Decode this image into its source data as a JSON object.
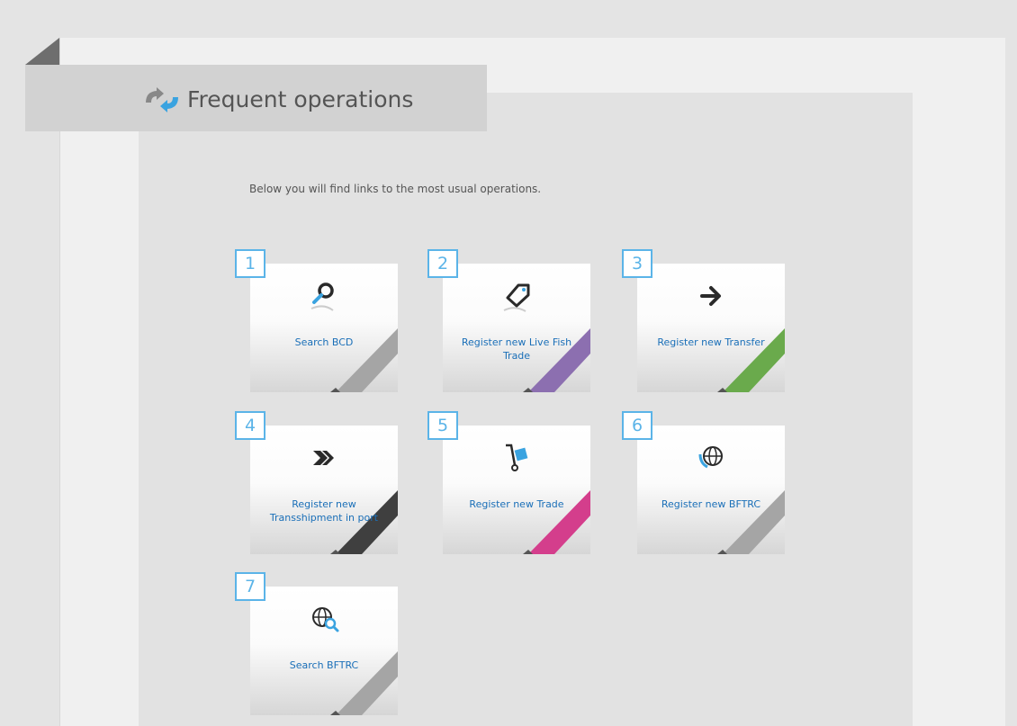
{
  "header": {
    "title": "Frequent operations",
    "icon": "refresh-arrows-icon"
  },
  "intro_text": "Below you will find links to the most usual operations.",
  "operations": [
    {
      "number": "1",
      "label": "Search BCD",
      "icon": "magnifier-icon",
      "ribbon_color": "#a5a5a5"
    },
    {
      "number": "2",
      "label": "Register new Live Fish Trade",
      "icon": "tag-icon",
      "ribbon_color": "#8c6fb0"
    },
    {
      "number": "3",
      "label": "Register new Transfer",
      "icon": "arrow-right-icon",
      "ribbon_color": "#6aaa4c"
    },
    {
      "number": "4",
      "label": "Register new Transshipment in port",
      "icon": "forward-arrows-icon",
      "ribbon_color": "#3f3f3f"
    },
    {
      "number": "5",
      "label": "Register new Trade",
      "icon": "hand-truck-icon",
      "ribbon_color": "#d43e8c"
    },
    {
      "number": "6",
      "label": "Register new BFTRC",
      "icon": "globe-icon",
      "ribbon_color": "#a5a5a5"
    },
    {
      "number": "7",
      "label": "Search BFTRC",
      "icon": "globe-search-icon",
      "ribbon_color": "#a5a5a5"
    }
  ],
  "colors": {
    "badge": "#5bb4e8",
    "link": "#1a6fb8",
    "header_bg": "#d2d2d2"
  }
}
